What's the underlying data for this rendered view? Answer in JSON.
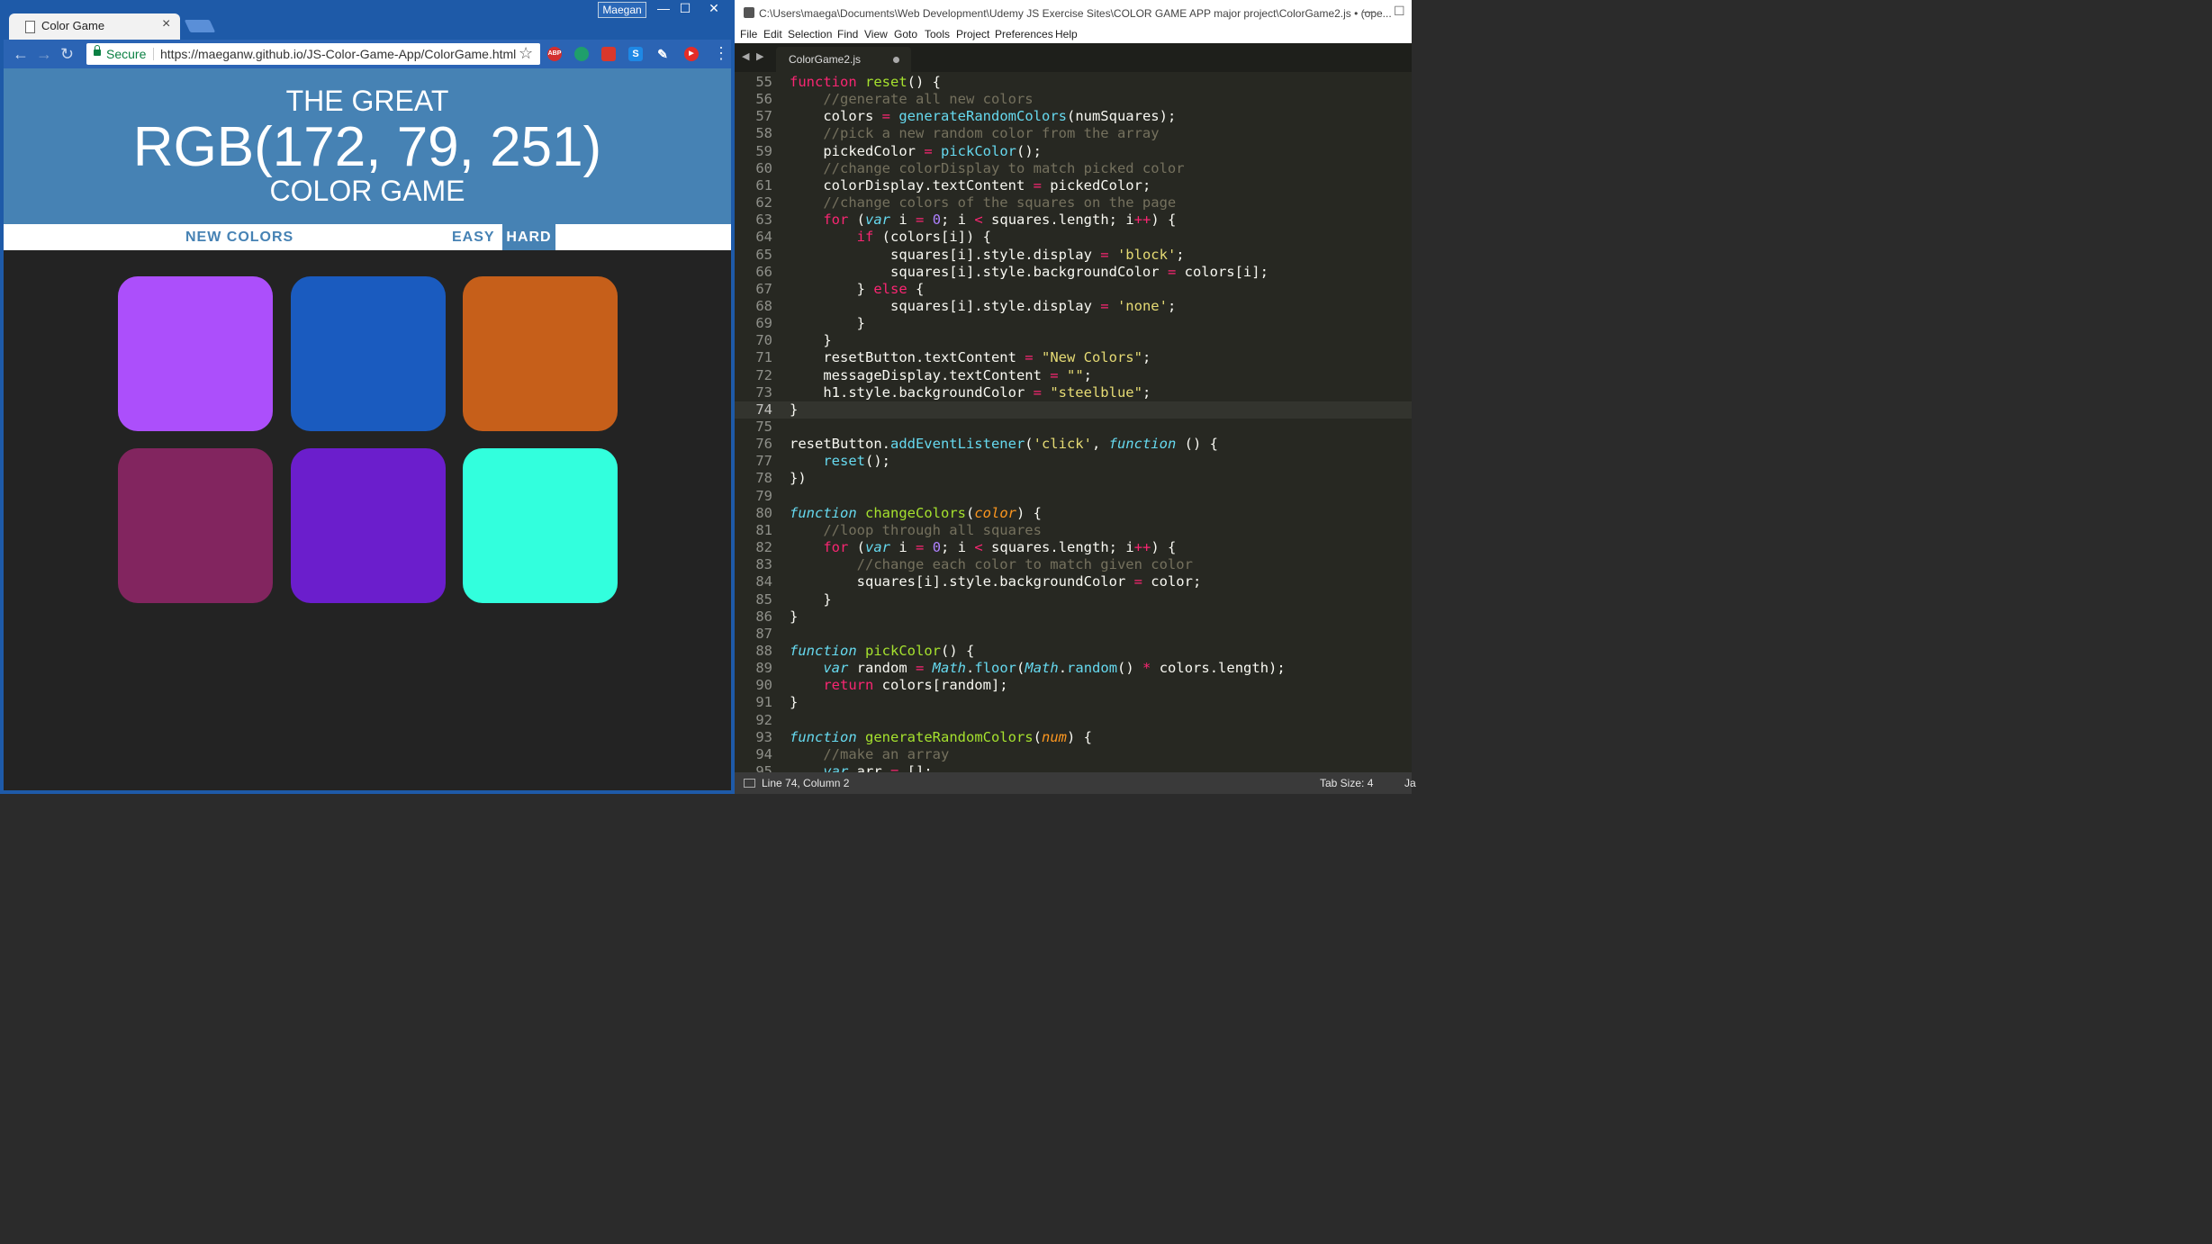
{
  "browser": {
    "tab_title": "Color Game",
    "tab_close": "×",
    "profile_name": "Maegan",
    "window_controls": {
      "minimize": "—",
      "maximize": "☐",
      "close": "✕"
    },
    "nav": {
      "back": "←",
      "forward": "→",
      "reload": "↻"
    },
    "secure_label": "Secure",
    "url": "https://maeganw.github.io/JS-Color-Game-App/ColorGame.html",
    "star": "☆",
    "extensions": {
      "abp": "ABP",
      "s": "S",
      "pen": "✎",
      "yt": "▶",
      "menu": "⋮"
    }
  },
  "game": {
    "header_line1": "THE GREAT",
    "header_rgb": "RGB(172, 79, 251)",
    "header_line3": "COLOR GAME",
    "header_color": "#4682b4",
    "new_colors_label": "NEW COLORS",
    "easy_label": "EASY",
    "hard_label": "HARD",
    "squares": [
      "#ac4ffb",
      "#1a5bbf",
      "#c65f1a",
      "#82255f",
      "#6b1ecc",
      "#32ffdd"
    ]
  },
  "editor": {
    "title": "C:\\Users\\maega\\Documents\\Web Development\\Udemy JS Exercise Sites\\COLOR GAME APP major project\\ColorGame2.js • (ope...",
    "window_controls": {
      "minimize": "—",
      "maximize": "☐"
    },
    "menu": [
      "File",
      "Edit",
      "Selection",
      "Find",
      "View",
      "Goto",
      "Tools",
      "Project",
      "Preferences",
      "Help"
    ],
    "tab_nav": {
      "prev": "◀",
      "next": "▶"
    },
    "tab_name": "ColorGame2.js",
    "active_line": 74,
    "lines": [
      {
        "n": "55",
        "t": [
          [
            "function",
            "kw",
            " st"
          ],
          [
            " "
          ],
          [
            "reset",
            "fn"
          ],
          [
            "() {"
          ]
        ]
      },
      {
        "n": "56",
        "t": [
          [
            "    "
          ],
          [
            "//generate all new colors",
            "c"
          ]
        ]
      },
      {
        "n": "57",
        "t": [
          [
            "    colors "
          ],
          [
            "=",
            "o"
          ],
          [
            " "
          ],
          [
            "generateRandomColors",
            "sp"
          ],
          [
            "(numSquares);"
          ]
        ]
      },
      {
        "n": "58",
        "t": [
          [
            "    "
          ],
          [
            "//pick a new random color from the array",
            "c"
          ]
        ]
      },
      {
        "n": "59",
        "t": [
          [
            "    pickedColor "
          ],
          [
            "=",
            "o"
          ],
          [
            " "
          ],
          [
            "pickColor",
            "sp"
          ],
          [
            "();"
          ]
        ]
      },
      {
        "n": "60",
        "t": [
          [
            "    "
          ],
          [
            "//change colorDisplay to match picked color",
            "c"
          ]
        ]
      },
      {
        "n": "61",
        "t": [
          [
            "    colorDisplay.textContent "
          ],
          [
            "=",
            "o"
          ],
          [
            " pickedColor;"
          ]
        ]
      },
      {
        "n": "62",
        "t": [
          [
            "    "
          ],
          [
            "//change colors of the squares on the page",
            "c"
          ]
        ]
      },
      {
        "n": "63",
        "t": [
          [
            "    "
          ],
          [
            "for",
            "kw"
          ],
          [
            " ("
          ],
          [
            "var",
            "st"
          ],
          [
            " i "
          ],
          [
            "=",
            "o"
          ],
          [
            " "
          ],
          [
            "0",
            "n"
          ],
          [
            "; i "
          ],
          [
            "<",
            "o"
          ],
          [
            " squares.length; i"
          ],
          [
            "++",
            "o"
          ],
          [
            ") {"
          ]
        ]
      },
      {
        "n": "64",
        "t": [
          [
            "        "
          ],
          [
            "if",
            "kw"
          ],
          [
            " (colors[i]) {"
          ]
        ]
      },
      {
        "n": "65",
        "t": [
          [
            "            squares[i].style.display "
          ],
          [
            "=",
            "o"
          ],
          [
            " "
          ],
          [
            "'block'",
            "s"
          ],
          [
            ";"
          ]
        ]
      },
      {
        "n": "66",
        "t": [
          [
            "            squares[i].style.backgroundColor "
          ],
          [
            "=",
            "o"
          ],
          [
            " colors[i];"
          ]
        ]
      },
      {
        "n": "67",
        "t": [
          [
            "        } "
          ],
          [
            "else",
            "kw"
          ],
          [
            " {"
          ]
        ]
      },
      {
        "n": "68",
        "t": [
          [
            "            squares[i].style.display "
          ],
          [
            "=",
            "o"
          ],
          [
            " "
          ],
          [
            "'none'",
            "s"
          ],
          [
            ";"
          ]
        ]
      },
      {
        "n": "69",
        "t": [
          [
            "        }"
          ]
        ]
      },
      {
        "n": "70",
        "t": [
          [
            "    }"
          ]
        ]
      },
      {
        "n": "71",
        "t": [
          [
            "    resetButton.textContent "
          ],
          [
            "=",
            "o"
          ],
          [
            " "
          ],
          [
            "\"New Colors\"",
            "s"
          ],
          [
            ";"
          ]
        ]
      },
      {
        "n": "72",
        "t": [
          [
            "    messageDisplay.textContent "
          ],
          [
            "=",
            "o"
          ],
          [
            " "
          ],
          [
            "\"\"",
            "s"
          ],
          [
            ";"
          ]
        ]
      },
      {
        "n": "73",
        "t": [
          [
            "    h1.style.backgroundColor "
          ],
          [
            "=",
            "o"
          ],
          [
            " "
          ],
          [
            "\"steelblue\"",
            "s"
          ],
          [
            ";"
          ]
        ]
      },
      {
        "n": "74",
        "t": [
          [
            "}"
          ]
        ]
      },
      {
        "n": "75",
        "t": [
          [
            ""
          ]
        ]
      },
      {
        "n": "76",
        "t": [
          [
            "resetButton."
          ],
          [
            "addEventListener",
            "sp"
          ],
          [
            "("
          ],
          [
            "'click'",
            "s"
          ],
          [
            ", "
          ],
          [
            "function",
            "st"
          ],
          [
            " () {"
          ]
        ]
      },
      {
        "n": "77",
        "t": [
          [
            "    "
          ],
          [
            "reset",
            "sp"
          ],
          [
            "();"
          ]
        ]
      },
      {
        "n": "78",
        "t": [
          [
            "})"
          ]
        ]
      },
      {
        "n": "79",
        "t": [
          [
            ""
          ]
        ]
      },
      {
        "n": "80",
        "t": [
          [
            "function",
            "st"
          ],
          [
            " "
          ],
          [
            "changeColors",
            "fn"
          ],
          [
            "("
          ],
          [
            "color",
            "pa"
          ],
          [
            ") {"
          ]
        ]
      },
      {
        "n": "81",
        "t": [
          [
            "    "
          ],
          [
            "//loop through all squares",
            "c"
          ]
        ]
      },
      {
        "n": "82",
        "t": [
          [
            "    "
          ],
          [
            "for",
            "kw"
          ],
          [
            " ("
          ],
          [
            "var",
            "st"
          ],
          [
            " i "
          ],
          [
            "=",
            "o"
          ],
          [
            " "
          ],
          [
            "0",
            "n"
          ],
          [
            "; i "
          ],
          [
            "<",
            "o"
          ],
          [
            " squares.length; i"
          ],
          [
            "++",
            "o"
          ],
          [
            ") {"
          ]
        ]
      },
      {
        "n": "83",
        "t": [
          [
            "        "
          ],
          [
            "//change each color to match given color",
            "c"
          ]
        ]
      },
      {
        "n": "84",
        "t": [
          [
            "        squares[i].style.backgroundColor "
          ],
          [
            "=",
            "o"
          ],
          [
            " color;"
          ]
        ]
      },
      {
        "n": "85",
        "t": [
          [
            "    }"
          ]
        ]
      },
      {
        "n": "86",
        "t": [
          [
            "}"
          ]
        ]
      },
      {
        "n": "87",
        "t": [
          [
            ""
          ]
        ]
      },
      {
        "n": "88",
        "t": [
          [
            "function",
            "st"
          ],
          [
            " "
          ],
          [
            "pickColor",
            "fn"
          ],
          [
            "() {"
          ]
        ]
      },
      {
        "n": "89",
        "t": [
          [
            "    "
          ],
          [
            "var",
            "st"
          ],
          [
            " random "
          ],
          [
            "=",
            "o"
          ],
          [
            " "
          ],
          [
            "Math",
            "st"
          ],
          [
            "."
          ],
          [
            "floor",
            "sp"
          ],
          [
            "("
          ],
          [
            "Math",
            "st"
          ],
          [
            "."
          ],
          [
            "random",
            "sp"
          ],
          [
            "() "
          ],
          [
            "*",
            "o"
          ],
          [
            " colors.length);"
          ]
        ]
      },
      {
        "n": "90",
        "t": [
          [
            "    "
          ],
          [
            "return",
            "kw"
          ],
          [
            " colors[random];"
          ]
        ]
      },
      {
        "n": "91",
        "t": [
          [
            "}"
          ]
        ]
      },
      {
        "n": "92",
        "t": [
          [
            ""
          ]
        ]
      },
      {
        "n": "93",
        "t": [
          [
            "function",
            "st"
          ],
          [
            " "
          ],
          [
            "generateRandomColors",
            "fn"
          ],
          [
            "("
          ],
          [
            "num",
            "pa"
          ],
          [
            ") {"
          ]
        ]
      },
      {
        "n": "94",
        "t": [
          [
            "    "
          ],
          [
            "//make an array",
            "c"
          ]
        ]
      },
      {
        "n": "95",
        "t": [
          [
            "    "
          ],
          [
            "var",
            "st"
          ],
          [
            " arr "
          ],
          [
            "=",
            "o"
          ],
          [
            " [];"
          ]
        ]
      }
    ],
    "status_position": "Line 74, Column 2",
    "status_tab": "Tab Size: 4",
    "status_syntax": "Ja"
  }
}
